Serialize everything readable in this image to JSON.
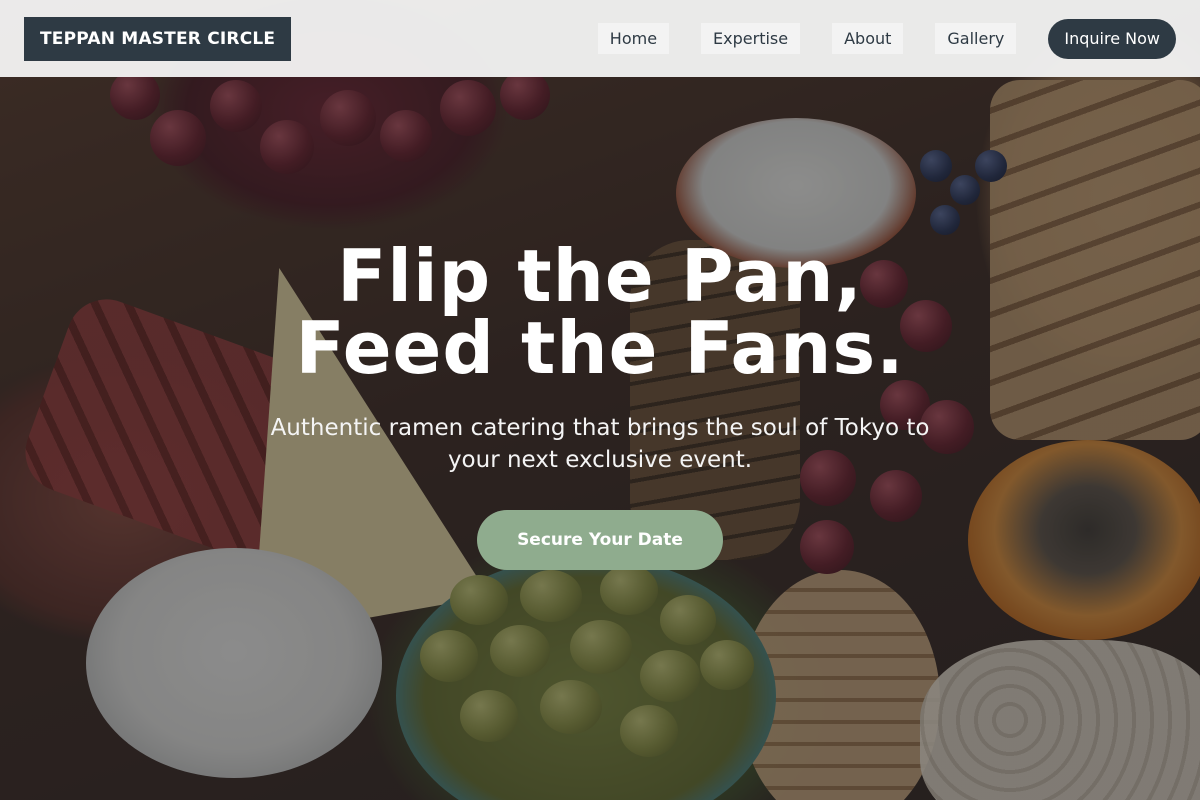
{
  "header": {
    "logo_text": "TEPPAN MASTER CIRCLE",
    "nav": [
      {
        "label": "Home"
      },
      {
        "label": "Expertise"
      },
      {
        "label": "About"
      },
      {
        "label": "Gallery"
      }
    ],
    "cta_label": "Inquire Now"
  },
  "hero": {
    "title_line1": "Flip the Pan,",
    "title_line2": "Feed the Fans.",
    "subtitle": "Authentic ramen catering that brings the soul of Tokyo to your next exclusive event.",
    "cta_label": "Secure Your Date",
    "background_image": "food-spread-photo"
  },
  "colors": {
    "primary_dark": "#2e3a44",
    "accent_sage": "#8fac8e",
    "header_bg": "#f4f4f4",
    "text_light": "#ffffff"
  }
}
